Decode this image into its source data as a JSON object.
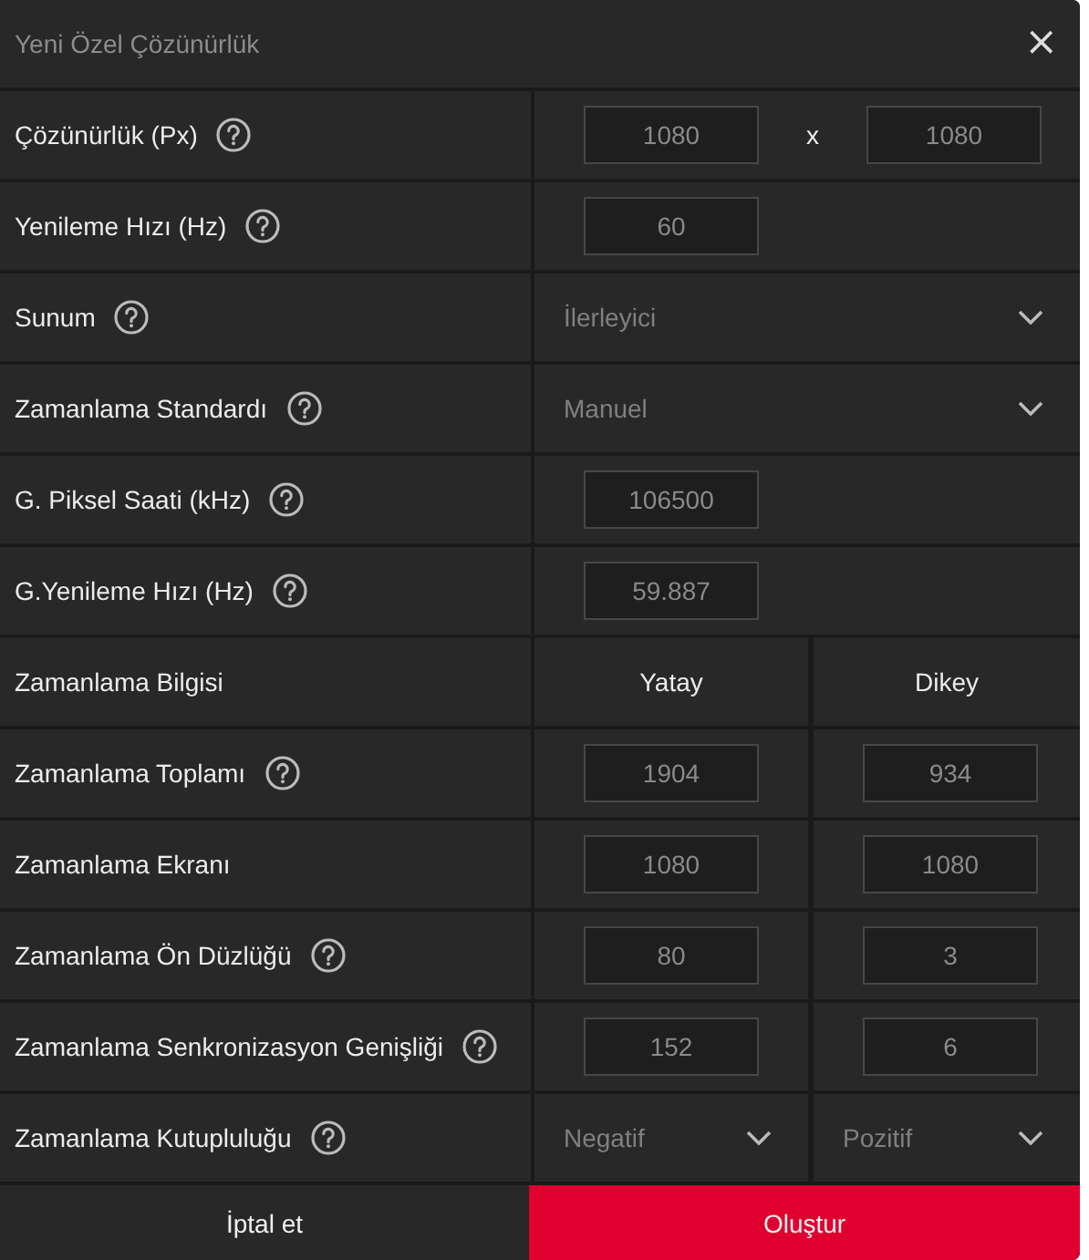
{
  "window": {
    "title": "Yeni Özel Çözünürlük",
    "close": "×"
  },
  "rows": [
    {
      "kind": "pair",
      "label": "Çözünürlük (Px)",
      "help": true,
      "values": [
        "1080",
        "1080"
      ],
      "separator": "x"
    },
    {
      "kind": "single",
      "label": "Yenileme Hızı (Hz)",
      "help": true,
      "values": [
        "60"
      ]
    },
    {
      "kind": "select",
      "label": "Sunum",
      "help": true,
      "values": [
        "İlerleyici"
      ]
    },
    {
      "kind": "select",
      "label": "Zamanlama Standardı",
      "help": true,
      "values": [
        "Manuel"
      ]
    },
    {
      "kind": "single",
      "label": "G. Piksel Saati (kHz)",
      "help": true,
      "values": [
        "106500"
      ]
    },
    {
      "kind": "single",
      "label": "G.Yenileme Hızı (Hz)",
      "help": true,
      "values": [
        "59.887"
      ]
    },
    {
      "kind": "header",
      "label": "Zamanlama Bilgisi",
      "help": false,
      "values": [
        "Yatay",
        "Dikey"
      ]
    },
    {
      "kind": "split",
      "label": "Zamanlama Toplamı",
      "help": true,
      "values": [
        "1904",
        "934"
      ]
    },
    {
      "kind": "split",
      "label": "Zamanlama Ekranı",
      "help": false,
      "values": [
        "1080",
        "1080"
      ]
    },
    {
      "kind": "split",
      "label": "Zamanlama Ön Düzlüğü",
      "help": true,
      "values": [
        "80",
        "3"
      ]
    },
    {
      "kind": "split",
      "label": "Zamanlama Senkronizasyon Genişliği",
      "help": true,
      "values": [
        "152",
        "6"
      ]
    },
    {
      "kind": "select2",
      "label": "Zamanlama Kutupluluğu",
      "help": true,
      "values": [
        "Negatif",
        "Pozitif"
      ]
    }
  ],
  "buttons": [
    {
      "label": "İptal et",
      "kind": "secondary"
    },
    {
      "label": "Oluştur",
      "kind": "primary"
    }
  ]
}
